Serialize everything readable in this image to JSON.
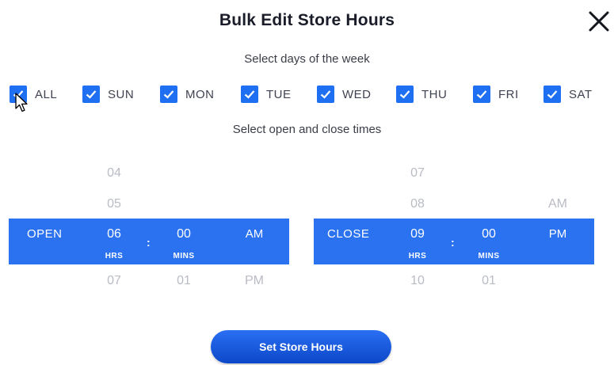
{
  "modal": {
    "title": "Bulk Edit Store Hours",
    "close_icon": "close-icon",
    "days_prompt": "Select days of the week",
    "times_prompt": "Select open and close times",
    "accent_color": "#2a72f0"
  },
  "days": [
    {
      "label": "ALL",
      "checked": true
    },
    {
      "label": "SUN",
      "checked": true
    },
    {
      "label": "MON",
      "checked": true
    },
    {
      "label": "TUE",
      "checked": true
    },
    {
      "label": "WED",
      "checked": true
    },
    {
      "label": "THU",
      "checked": true
    },
    {
      "label": "FRI",
      "checked": true
    },
    {
      "label": "SAT",
      "checked": true
    }
  ],
  "open": {
    "label": "OPEN",
    "hours_above": [
      "04",
      "05"
    ],
    "hour": "06",
    "hour_below": "07",
    "minute": "00",
    "minute_below": "01",
    "ampm": "AM",
    "ampm_below": "PM",
    "hrs_unit": "HRS",
    "mins_unit": "MINS",
    "separator": ":"
  },
  "close": {
    "label": "CLOSE",
    "hours_above": [
      "07",
      "08"
    ],
    "hour": "09",
    "hour_below": "10",
    "minute": "00",
    "minute_below": "01",
    "ampm_above": "AM",
    "ampm": "PM",
    "hrs_unit": "HRS",
    "mins_unit": "MINS",
    "separator": ":"
  },
  "submit_label": "Set Store Hours"
}
